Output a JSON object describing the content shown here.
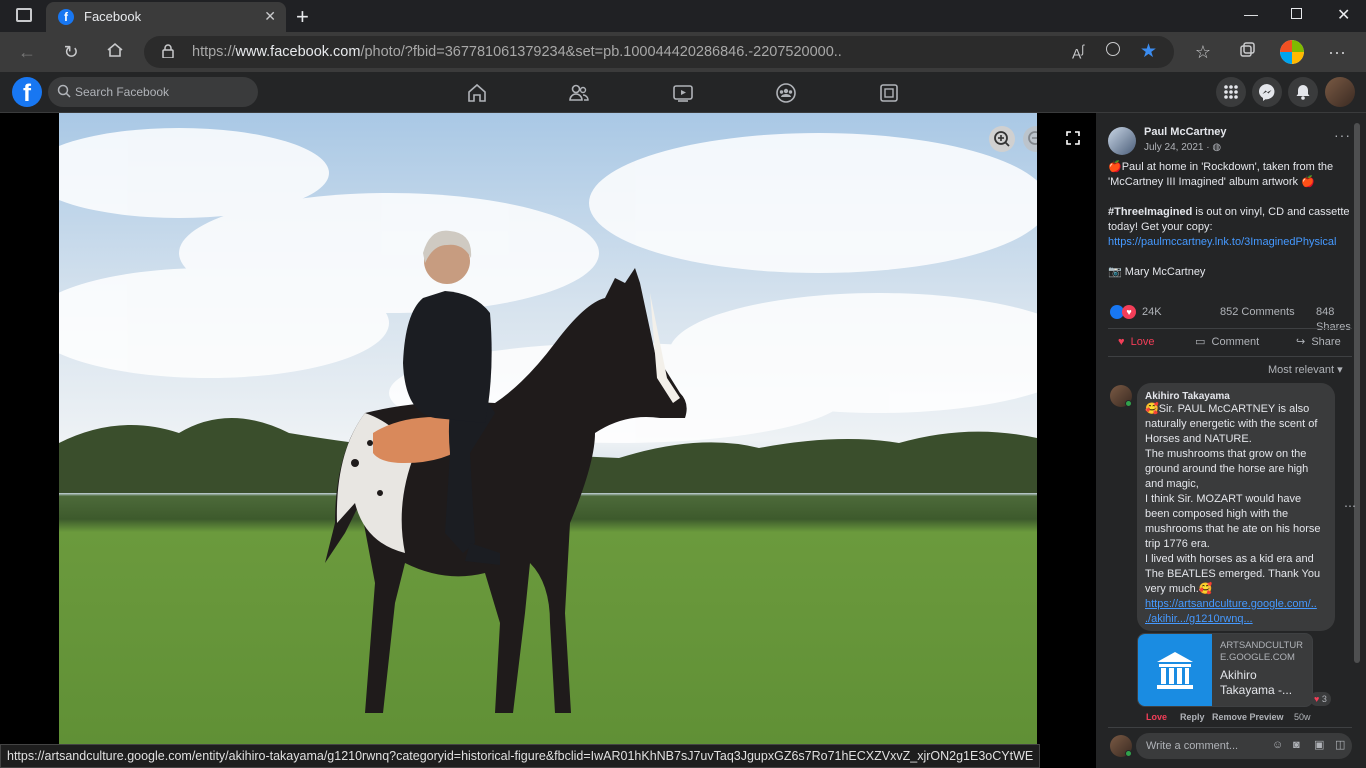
{
  "browser": {
    "tab_title": "Facebook",
    "tab_favicon": "facebook-icon",
    "url_prefix": "https://",
    "url_host": "www.facebook.com",
    "url_rest": "/photo/?fbid=367781061379234&set=pb.100044420286846.-2207520000..",
    "status_url": "https://artsandculture.google.com/entity/akihiro-takayama/g1210rwnq?categoryid=historical-figure&fbclid=IwAR01hKhNB7sJ7uvTaq3JgupxGZ6s7Ro71hECXZVxvZ_xjrON2g1E3oCYtWE"
  },
  "fb": {
    "search_placeholder": "Search Facebook",
    "accent": "#1877f2"
  },
  "post": {
    "author": "Paul McCartney",
    "date": "July 24, 2021 ·",
    "line1": "🍎Paul at home in 'Rockdown', taken from the",
    "line2": "'McCartney III Imagined' album artwork 🍎",
    "hashtag": "#ThreeImagined",
    "line3_rest": " is out on vinyl, CD and cassette",
    "line4": "today! Get your copy:",
    "link": "https://paulmccartney.lnk.to/3ImaginedPhysical",
    "credit": "📷 Mary McCartney",
    "reactions_count": "24K",
    "comments_count": "852 Comments",
    "shares_count": "848 Shares",
    "love_label": "Love",
    "comment_label": "Comment",
    "share_label": "Share",
    "sort_label": "Most relevant"
  },
  "comment": {
    "author": "Akihiro Takayama",
    "lines": [
      "🥰Sir. PAUL McCARTNEY is also",
      "naturally energetic with the scent of",
      "Horses and NATURE.",
      "The mushrooms that grow on the",
      "ground around the horse are high",
      "and magic,",
      "I think Sir. MOZART would have",
      "been composed high with the",
      "mushrooms that he ate on his horse",
      "trip 1776 era.",
      "I lived with horses as a kid era and",
      "The BEATLES emerged. Thank You",
      "very much.🥰"
    ],
    "link1": "https://artsandculture.google.com/..",
    "link2": "./akihir.../g1210rwnq...",
    "preview_domain1": "ARTSANDCULTUR",
    "preview_domain2": "E.GOOGLE.COM",
    "preview_title1": "Akihiro",
    "preview_title2": "Takayama -...",
    "reaction_count": "3",
    "action_love": "Love",
    "action_reply": "Reply",
    "action_remove": "Remove Preview",
    "age": "50w"
  },
  "composer": {
    "placeholder": "Write a comment..."
  }
}
